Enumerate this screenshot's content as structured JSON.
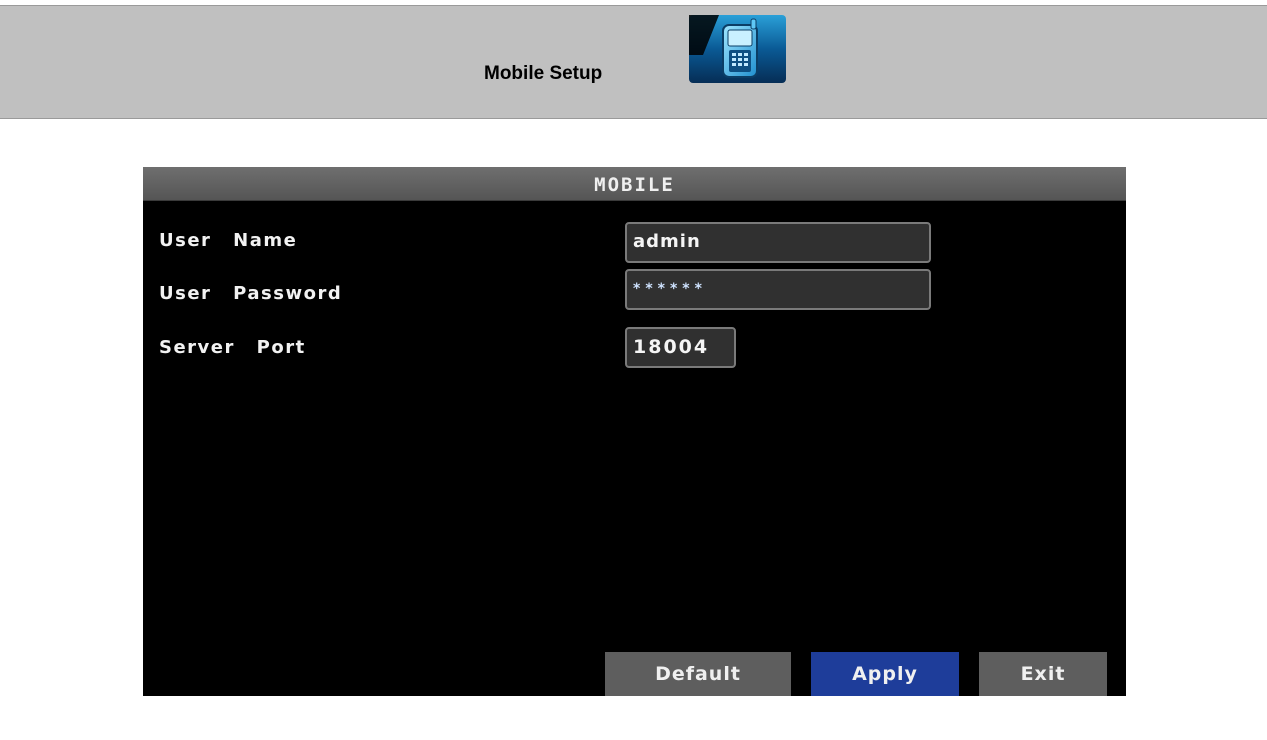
{
  "header": {
    "title": "Mobile Setup",
    "icon": "mobile-phone-icon"
  },
  "dialog": {
    "title": "MOBILE",
    "fields": [
      {
        "label": "User Name",
        "value": "admin"
      },
      {
        "label": "User Password",
        "value": "******"
      },
      {
        "label": "Server Port",
        "value": "18004"
      }
    ],
    "buttons": {
      "default": "Default",
      "apply": "Apply",
      "exit": "Exit"
    }
  },
  "colors": {
    "header_bg": "#c0c0c0",
    "dialog_bg": "#000000",
    "titlebar_bg": "#5e5e5e",
    "apply_button_bg": "#1e3d9a",
    "button_bg": "#5e5e5e"
  }
}
